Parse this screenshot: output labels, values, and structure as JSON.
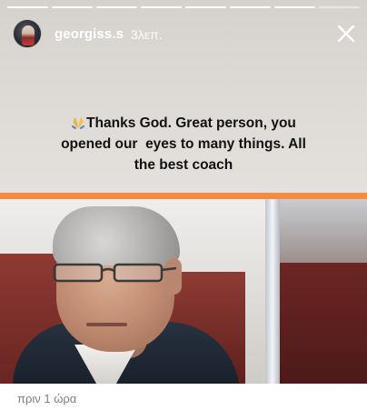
{
  "story": {
    "username": "georgiss.s",
    "time": "3λεπ.",
    "segments": 8,
    "caption_lines": [
      "Thanks God. Great person, you",
      "opened our  eyes to many things. All",
      "the best coach"
    ],
    "accent_color": "#f58a41",
    "icons": [
      "avatar",
      "close-icon",
      "folded-hands-emoji"
    ]
  },
  "post": {
    "time_ago": "πριν 1 ώρα"
  }
}
